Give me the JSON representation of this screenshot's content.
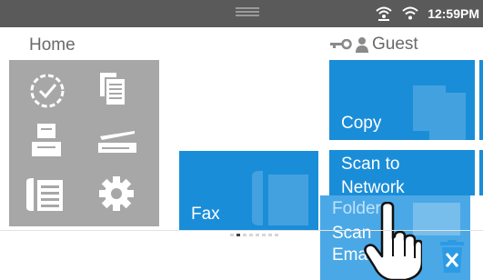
{
  "status_bar": {
    "time": "12:59PM"
  },
  "header": {
    "home_label": "Home",
    "user_label": "Guest"
  },
  "apps": [
    {
      "icon": "clock-check-icon"
    },
    {
      "icon": "documents-icon"
    },
    {
      "icon": "printer-icon"
    },
    {
      "icon": "scanner-icon"
    },
    {
      "icon": "fax-phone-icon"
    },
    {
      "icon": "settings-gear-icon"
    }
  ],
  "tiles": {
    "copy": {
      "label": "Copy"
    },
    "fax": {
      "label": "Fax"
    },
    "scan_network": {
      "line1": "Scan to",
      "line2": "Network",
      "line3": "Folder"
    },
    "scan_email": {
      "line1": "Scan",
      "line2": "Email"
    }
  },
  "colors": {
    "tile_blue": "#1a8dd8",
    "panel_grey": "#a7a7a7",
    "statusbar": "#5a5a5a"
  },
  "pagination": {
    "pages": 8,
    "current": 2
  }
}
